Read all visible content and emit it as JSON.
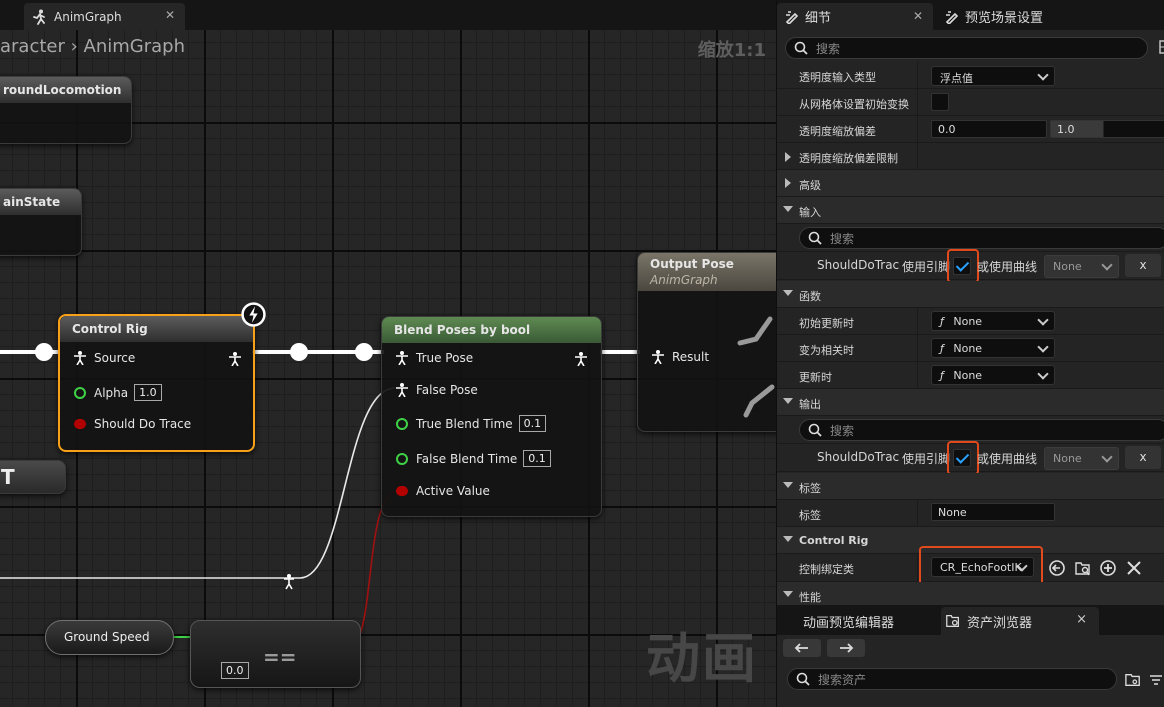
{
  "graph": {
    "tab_title": "AnimGraph",
    "breadcrumb_parent": "aracter",
    "breadcrumb_current": "AnimGraph",
    "zoom_label": "缩放1:1",
    "watermark": "动画",
    "nodes": {
      "ground_locomotion": "roundLocomotion",
      "main_state": "ainState",
      "partial_t": "T",
      "control_rig": {
        "title": "Control Rig",
        "pin_source": "Source",
        "pin_alpha": "Alpha",
        "alpha_value": "1.0",
        "pin_trace": "Should Do Trace"
      },
      "blend_poses": {
        "title": "Blend Poses by bool",
        "pin_true_pose": "True Pose",
        "pin_false_pose": "False Pose",
        "pin_true_blend": "True Blend Time",
        "true_blend_value": "0.1",
        "pin_false_blend": "False Blend Time",
        "false_blend_value": "0.1",
        "pin_active": "Active Value"
      },
      "output_pose": {
        "title": "Output Pose",
        "subtitle": "AnimGraph",
        "pin_result": "Result"
      },
      "ground_speed": "Ground Speed",
      "equals": {
        "op": "==",
        "value": "0.0"
      }
    }
  },
  "details": {
    "tab_details": "细节",
    "tab_preview": "预览场景设置",
    "search_placeholder": "搜索",
    "rows": {
      "alpha_input_type_label": "透明度输入类型",
      "alpha_input_type_value": "浮点值",
      "init_from_mesh_label": "从网格体设置初始变换",
      "alpha_scale_bias_label": "透明度缩放偏差",
      "alpha_scale_min": "0.0",
      "alpha_scale_max": "1.0",
      "alpha_scale_clamp_label": "透明度缩放偏差限制"
    },
    "categories": {
      "advanced": "高级",
      "input": "输入",
      "functions": "函数",
      "output": "输出",
      "tags": "标签",
      "control_rig": "Control Rig",
      "performance": "性能"
    },
    "input_section": {
      "search_placeholder": "搜索",
      "var_name": "ShouldDoTrac",
      "use_pin": "使用引脚",
      "or_curve": "或使用曲线",
      "curve_value": "None",
      "clear": "x"
    },
    "functions_section": {
      "on_initial_update_label": "初始更新时",
      "on_initial_update_value": "None",
      "on_become_relevant_label": "变为相关时",
      "on_become_relevant_value": "None",
      "on_update_label": "更新时",
      "on_update_value": "None",
      "func_glyph": "ƒ"
    },
    "output_section": {
      "search_placeholder": "搜索",
      "var_name": "ShouldDoTrac",
      "use_pin": "使用引脚",
      "or_curve": "或使用曲线",
      "curve_value": "None",
      "clear": "x"
    },
    "tags_section": {
      "tag_label": "标签",
      "tag_value": "None"
    },
    "control_rig_section": {
      "class_label": "控制绑定类",
      "class_value": "CR_EchoFootIK"
    }
  },
  "browser": {
    "tab_anim_preview": "动画预览编辑器",
    "tab_content": "资产浏览器",
    "close": "×",
    "search_placeholder": "搜索资产"
  },
  "colors": {
    "selection_outline": "#f7a11a",
    "highlight_box": "#e04a1c",
    "check_blue": "#2aa2ff",
    "exec_white": "#ffffff",
    "float_green": "#3fd146",
    "bool_red": "#b30000"
  },
  "icons": [
    "anim-graph-icon",
    "close-icon",
    "details-icon",
    "preview-scene-icon",
    "search-icon",
    "chevron-down-icon",
    "function-icon",
    "browse-icon",
    "find-asset-icon",
    "add-icon",
    "pose-icon",
    "lightning-icon",
    "back-arrow-icon",
    "forward-arrow-icon",
    "folder-icon",
    "filter-icon"
  ]
}
